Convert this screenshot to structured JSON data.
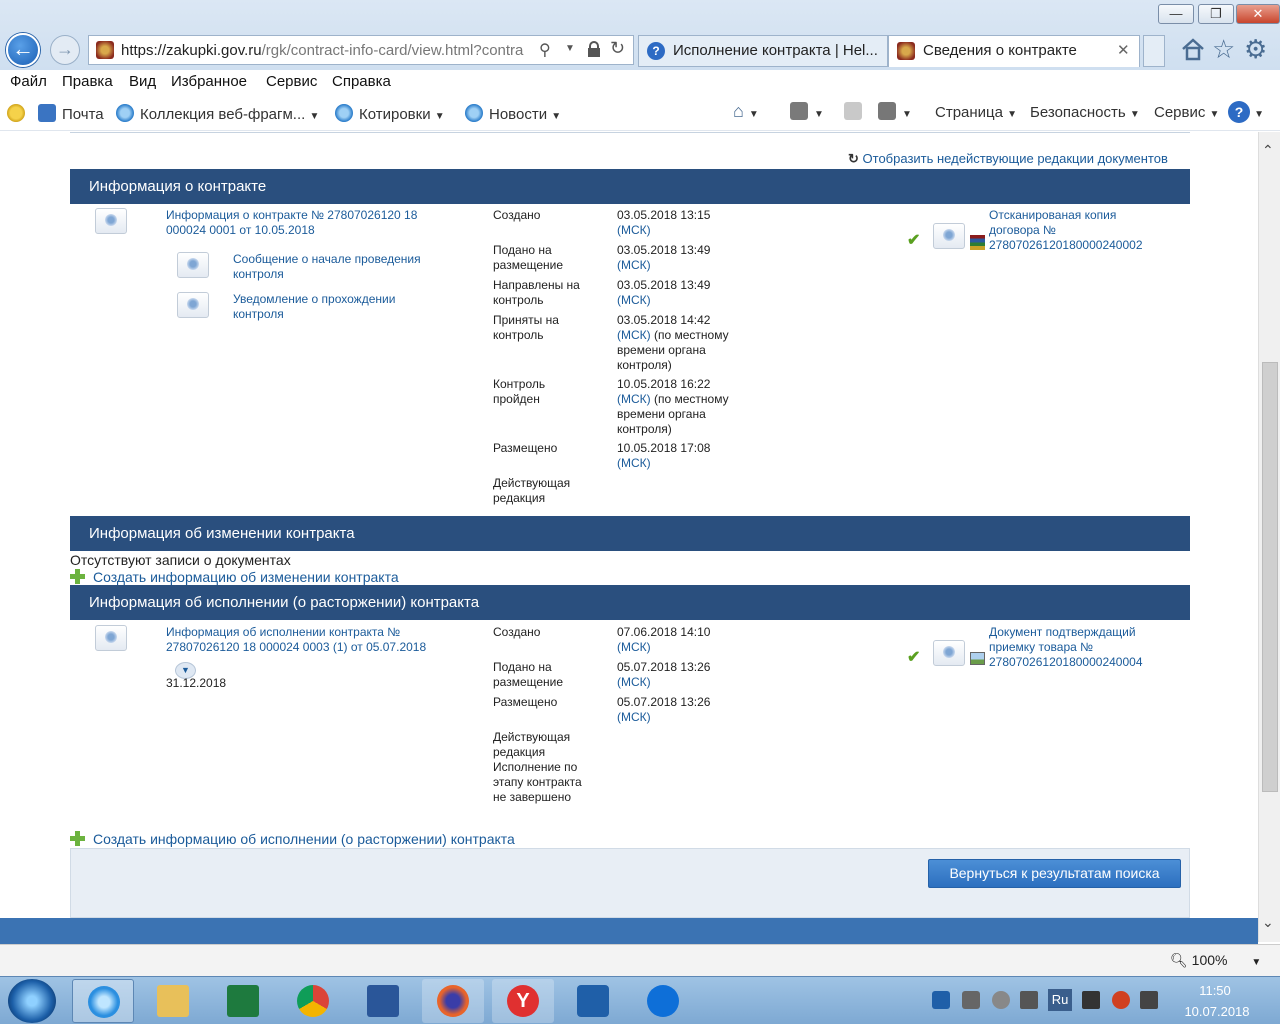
{
  "browser": {
    "window_controls": {
      "minimize": "—",
      "restore": "❐",
      "close": "✕"
    },
    "back_icon": "←",
    "forward_icon": "→",
    "address": {
      "host": "https://zakupki.gov.ru",
      "path": "/rgk/contract-info-card/view.html?contra"
    },
    "tabs": [
      {
        "label": "Исполнение контракта | Hel..."
      },
      {
        "label": "Сведения о контракте",
        "close": "✕"
      }
    ],
    "menu": [
      "Файл",
      "Правка",
      "Вид",
      "Избранное",
      "Сервис",
      "Справка"
    ],
    "favorites": [
      "Почта",
      "Коллекция веб-фрагм...",
      "Котировки",
      "Новости"
    ],
    "commands": [
      "Страница",
      "Безопасность",
      "Сервис"
    ],
    "help": "?",
    "zoom": "100%"
  },
  "page": {
    "show_inactive_link": "Отобразить недействующие редакции документов",
    "contract_section": {
      "title": "Информация о контракте",
      "main_doc": "Информация о контракте № 27807026120 18 000024 0001 от 10.05.2018",
      "sub_docs": [
        "Сообщение о начале проведения контроля",
        "Уведомление о прохождении контроля"
      ],
      "events": [
        {
          "label": "Создано",
          "value": "03.05.2018 13:15",
          "tz": "(МСК)",
          "note": ""
        },
        {
          "label": "Подано на размещение",
          "value": "03.05.2018 13:49",
          "tz": "(МСК)",
          "note": ""
        },
        {
          "label": "Направлены на контроль",
          "value": "03.05.2018 13:49",
          "tz": "(МСК)",
          "note": ""
        },
        {
          "label": "Приняты на контроль",
          "value": "03.05.2018 14:42",
          "tz": "(МСК)",
          "note": " (по местному времени органа контроля)"
        },
        {
          "label": "Контроль пройден",
          "value": "10.05.2018 16:22",
          "tz": "(МСК)",
          "note": " (по местному времени органа контроля)"
        },
        {
          "label": "Размещено",
          "value": "10.05.2018 17:08",
          "tz": "(МСК)",
          "note": ""
        },
        {
          "label": "Действующая редакция",
          "value": "",
          "tz": "",
          "note": ""
        }
      ],
      "attachment": "Отсканированая копия договора № 27807026120180000240002"
    },
    "change_section": {
      "title": "Информация об изменении контракта",
      "empty_text": "Отсутствуют записи о документах",
      "create_link": "Создать информацию об изменении контракта"
    },
    "execution_section": {
      "title": "Информация об исполнении (о расторжении) контракта",
      "main_doc": "Информация об исполнении контракта № 27807026120 18 000024 0003 (1) от 05.07.2018",
      "date": "31.12.2018",
      "events": [
        {
          "label": "Создано",
          "value": "07.06.2018 14:10",
          "tz": "(МСК)"
        },
        {
          "label": "Подано на размещение",
          "value": "05.07.2018 13:26",
          "tz": "(МСК)"
        },
        {
          "label": "Размещено",
          "value": "05.07.2018 13:26",
          "tz": "(МСК)"
        },
        {
          "label": "Действующая редакция Исполнение по этапу контракта не завершено",
          "value": "",
          "tz": ""
        }
      ],
      "attachment": "Документ подтверждащий приемку товара № 27807026120180000240004",
      "create_link": "Создать информацию об исполнении (о расторжении) контракта"
    },
    "back_button": "Вернуться к результатам поиска"
  },
  "taskbar": {
    "lang": "Ru",
    "time": "11:50",
    "date": "10.07.2018",
    "apps": [
      "windows-explorer",
      "internet-explorer",
      "file-explorer",
      "excel",
      "chrome",
      "word",
      "firefox",
      "yandex-browser",
      "yandex-disk",
      "teamviewer"
    ]
  }
}
